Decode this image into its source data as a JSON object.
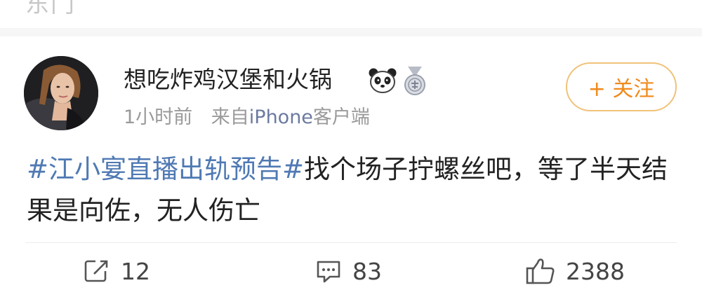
{
  "previous_item": {
    "clipped_text": "东门"
  },
  "post": {
    "author": {
      "name": "想吃炸鸡汉堡和火锅"
    },
    "meta": {
      "time": "1小时前",
      "source_prefix": "来自",
      "source_device": "iPhone",
      "source_suffix": "客户端"
    },
    "follow_label": "+ 关注",
    "content": {
      "hashtag": "#江小宴直播出轨预告#",
      "text": "找个场子拧螺丝吧，等了半天结果是向佐，无人伤亡"
    },
    "actions": {
      "repost_count": "12",
      "comment_count": "83",
      "like_count": "2388"
    }
  },
  "colors": {
    "hashtag": "#4f79b3",
    "follow": "#f08a1c",
    "meta": "#9a9a9a"
  },
  "icons": {
    "badge_1": "panda-icon",
    "badge_2": "medal-icon",
    "repost": "repost-icon",
    "comment": "comment-icon",
    "like": "thumbs-up-icon"
  }
}
